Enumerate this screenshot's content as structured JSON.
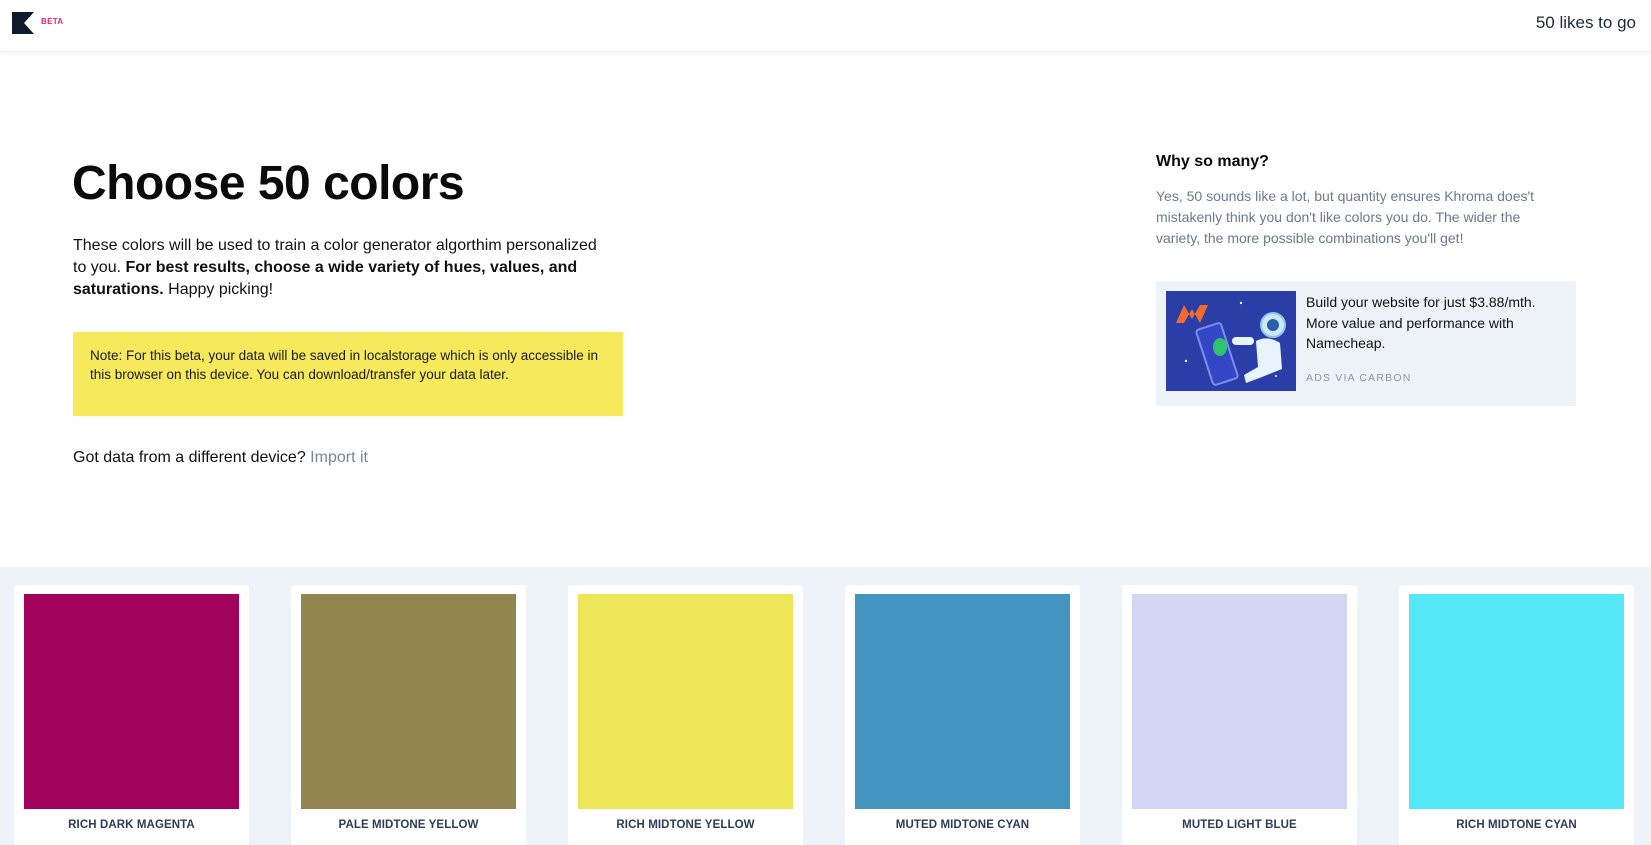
{
  "header": {
    "beta_label": "BETA",
    "likes_text": "50 likes to go"
  },
  "intro": {
    "title": "Choose 50 colors",
    "text_part1": "These colors will be used to train a color generator algorthim personalized to you. ",
    "text_bold": "For best results, choose a wide variety of hues, values, and saturations.",
    "text_part2": " Happy picking!",
    "note": "Note: For this beta, your data will be saved in localstorage which is only accessible in this browser on this device. You can download/transfer your data later.",
    "import_question": "Got data from a different device? ",
    "import_link": "Import it"
  },
  "sidebar": {
    "why_title": "Why so many?",
    "why_text": "Yes, 50 sounds like a lot, but quantity ensures Khroma does't mistakenly think you don't like colors you do. The wider the variety, the more possible combinations you'll get!",
    "ad": {
      "text": "Build your website for just $3.88/mth. More value and performance with Namecheap.",
      "via": "ADS VIA CARBON",
      "image_icon": "namecheap-astronaut-illustration"
    }
  },
  "swatches": [
    {
      "label": "RICH DARK MAGENTA",
      "color": "#a1035c"
    },
    {
      "label": "PALE MIDTONE YELLOW",
      "color": "#928550"
    },
    {
      "label": "RICH MIDTONE YELLOW",
      "color": "#eee659"
    },
    {
      "label": "MUTED MIDTONE CYAN",
      "color": "#4496c1"
    },
    {
      "label": "MUTED LIGHT BLUE",
      "color": "#d4d6f5"
    },
    {
      "label": "RICH MIDTONE CYAN",
      "color": "#57e8f8"
    }
  ],
  "colors": {
    "accent_beta": "#e8267b",
    "note_bg": "#f7e95c",
    "section_bg": "#eef3fa",
    "link": "#7a8599"
  }
}
